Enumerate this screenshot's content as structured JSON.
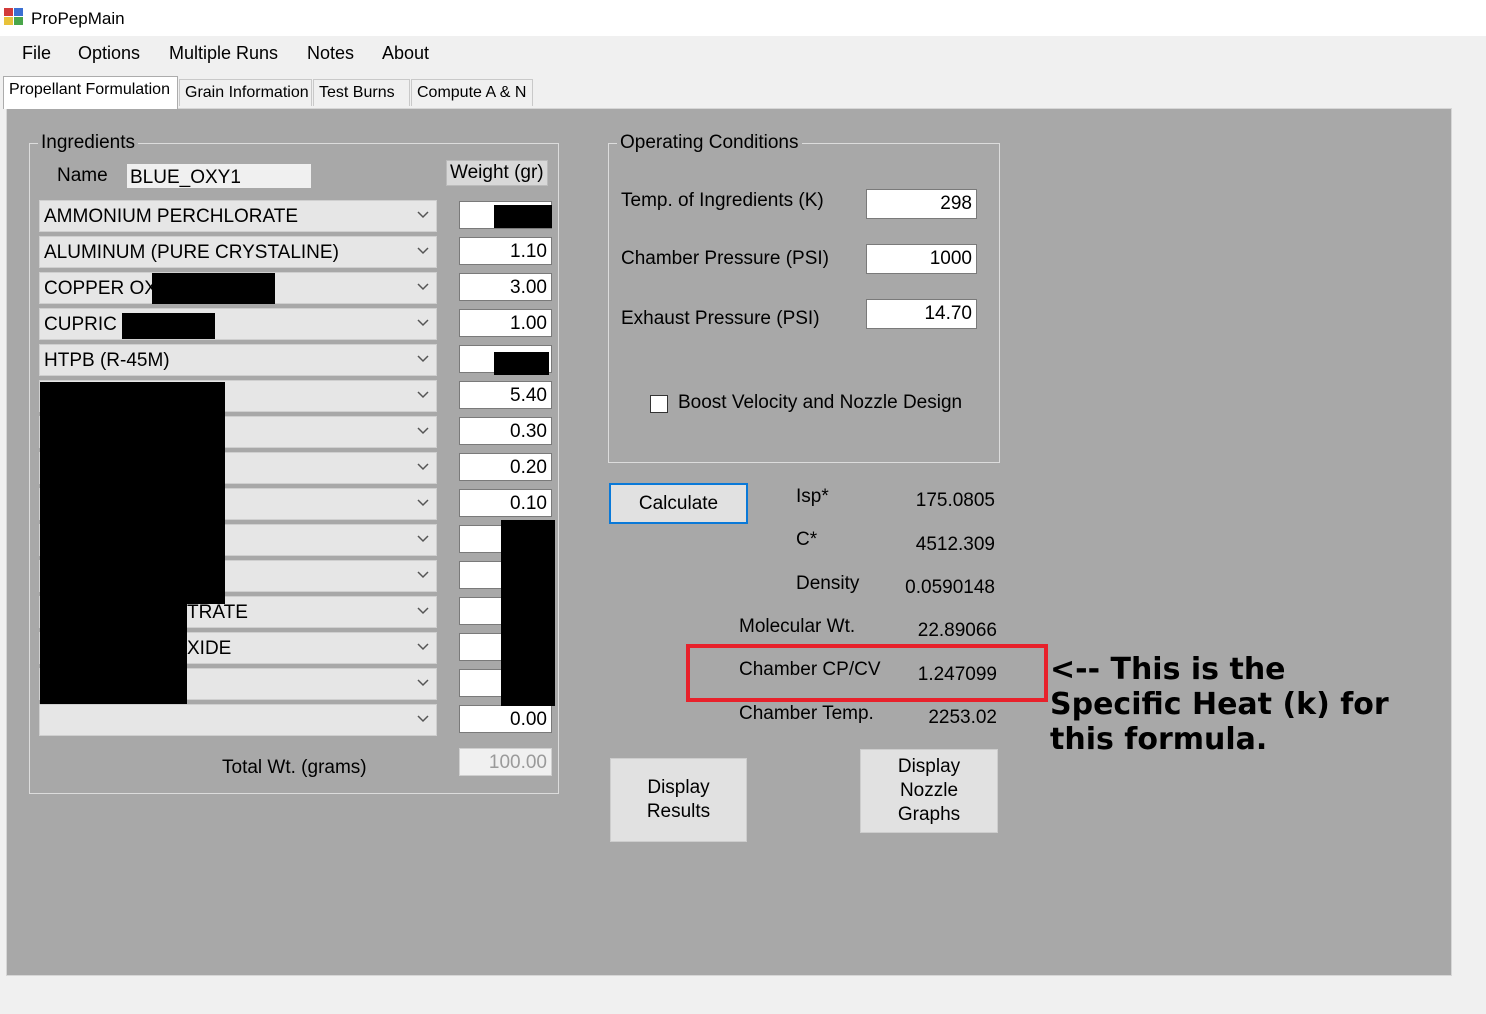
{
  "window": {
    "title": "ProPepMain"
  },
  "menu": [
    "File",
    "Options",
    "Multiple Runs",
    "Notes",
    "About"
  ],
  "tabs": [
    "Propellant Formulation",
    "Grain Information",
    "Test Burns",
    "Compute A & N"
  ],
  "ingredients": {
    "group_title": "Ingredients",
    "name_label": "Name",
    "name_value": "BLUE_OXY1",
    "weight_header": "Weight (gr)",
    "rows": [
      {
        "name": "AMMONIUM PERCHLORATE",
        "weight": ""
      },
      {
        "name": "ALUMINUM (PURE CRYSTALINE)",
        "weight": "1.10"
      },
      {
        "name": "COPPER OX",
        "weight": "3.00"
      },
      {
        "name": "CUPRIC",
        "weight": "1.00"
      },
      {
        "name": "HTPB (R-45M)",
        "weight": ""
      },
      {
        "name": "",
        "weight": "5.40"
      },
      {
        "name": "",
        "weight": "0.30"
      },
      {
        "name": "",
        "weight": "0.20"
      },
      {
        "name": "",
        "weight": "0.10"
      },
      {
        "name": "",
        "weight": ""
      },
      {
        "name": "",
        "weight": ""
      },
      {
        "name": "TRATE",
        "weight": ""
      },
      {
        "name": "XIDE",
        "weight": ""
      },
      {
        "name": "",
        "weight": ""
      },
      {
        "name": "",
        "weight": "0.00"
      }
    ],
    "total_label": "Total Wt. (grams)",
    "total_value": "100.00"
  },
  "operating": {
    "group_title": "Operating Conditions",
    "temp_label": "Temp. of Ingredients (K)",
    "temp_value": "298",
    "chamber_label": "Chamber Pressure (PSI)",
    "chamber_value": "1000",
    "exhaust_label": "Exhaust Pressure (PSI)",
    "exhaust_value": "14.70",
    "boost_label": "Boost Velocity and Nozzle Design",
    "boost_checked": false
  },
  "results": {
    "calculate_label": "Calculate",
    "isp_label": "Isp*",
    "isp_value": "175.0805",
    "cstar_label": "C*",
    "cstar_value": "4512.309",
    "density_label": "Density",
    "density_value": "0.0590148",
    "molwt_label": "Molecular Wt.",
    "molwt_value": "22.89066",
    "cpcv_label": "Chamber CP/CV",
    "cpcv_value": "1.247099",
    "ctemp_label": "Chamber Temp.",
    "ctemp_value": "2253.02"
  },
  "buttons": {
    "display_results": [
      "Display",
      "Results"
    ],
    "display_nozzle": [
      "Display",
      "Nozzle",
      "Graphs"
    ]
  },
  "annotation": {
    "lines": [
      "<-- This is the",
      "Specific Heat (k) for",
      "this formula."
    ],
    "highlight_color": "#e8212b"
  }
}
